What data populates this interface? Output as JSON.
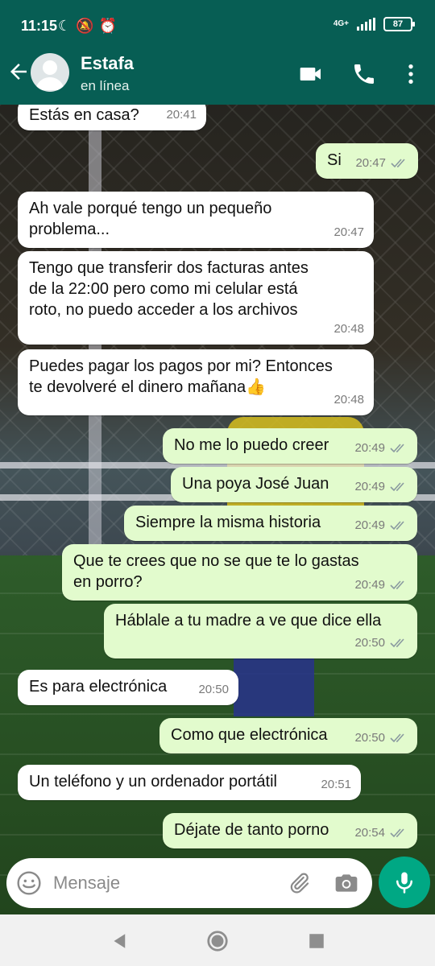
{
  "status_bar": {
    "time": "11:15",
    "network": "4G+",
    "battery": "87"
  },
  "header": {
    "contact_name": "Estafa",
    "presence": "en línea"
  },
  "messages": [
    {
      "dir": "in",
      "text": "Estás en casa?",
      "time": "20:41"
    },
    {
      "dir": "out",
      "text": "Si",
      "time": "20:47",
      "read": true
    },
    {
      "dir": "in",
      "text": "Ah vale porqué tengo un pequeño\nproblema...",
      "time": "20:47"
    },
    {
      "dir": "in",
      "text": "Tengo que transferir dos facturas antes\nde la 22:00 pero como mi celular está\nroto, no puedo acceder a los archivos",
      "time": "20:48"
    },
    {
      "dir": "in",
      "text": "Puedes pagar los pagos por mi? Entonces\nte devolveré el dinero mañana👍",
      "time": "20:48"
    },
    {
      "dir": "out",
      "text": "No me lo puedo creer",
      "time": "20:49",
      "read": true
    },
    {
      "dir": "out",
      "text": "Una poya José Juan",
      "time": "20:49",
      "read": true
    },
    {
      "dir": "out",
      "text": "Siempre la misma historia",
      "time": "20:49",
      "read": true
    },
    {
      "dir": "out",
      "text": "Que te crees que no se que te lo gastas\nen porro?",
      "time": "20:49",
      "read": true
    },
    {
      "dir": "out",
      "text": "Háblale a tu madre a ve que dice ella",
      "time": "20:50",
      "read": true
    },
    {
      "dir": "in",
      "text": "Es para electrónica",
      "time": "20:50"
    },
    {
      "dir": "out",
      "text": "Como que electrónica",
      "time": "20:50",
      "read": true
    },
    {
      "dir": "in",
      "text": "Un teléfono y un ordenador portátil",
      "time": "20:51"
    },
    {
      "dir": "out",
      "text": "Déjate de tanto porno",
      "time": "20:54",
      "read": true
    }
  ],
  "composer": {
    "placeholder": "Mensaje"
  },
  "colors": {
    "header": "#075e54",
    "outgoing_bubble": "#e2fbcd",
    "incoming_bubble": "#ffffff",
    "mic_button": "#00a884",
    "read_ticks": "#8a9aa0"
  }
}
